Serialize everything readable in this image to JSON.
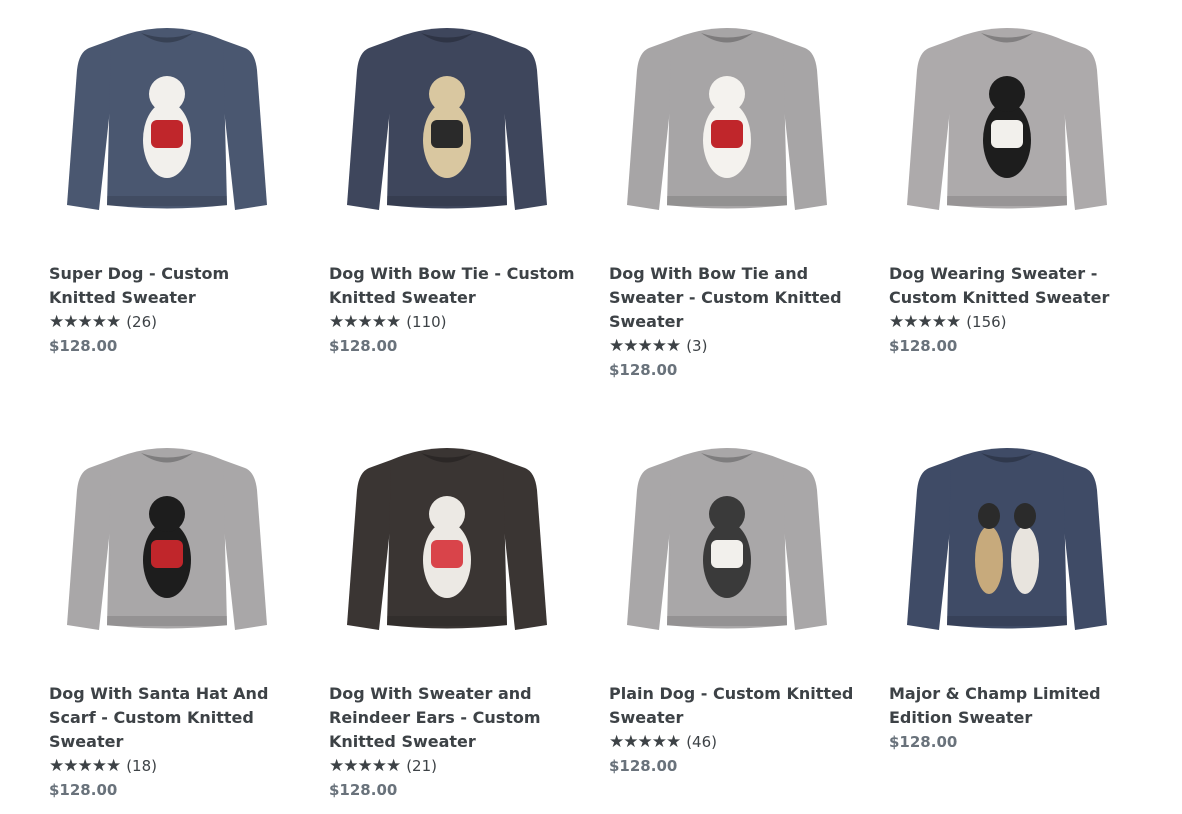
{
  "products": [
    {
      "title": "Super Dog - Custom Knitted Sweater",
      "stars_icon": "star-rating-icon",
      "rating": 5,
      "review_count": "(26)",
      "price": "$128.00",
      "sweater_color": "#4a5770",
      "dog_color": "#f2f0ec",
      "accent_color": "#c0262b"
    },
    {
      "title": "Dog With Bow Tie - Custom Knitted Sweater",
      "stars_icon": "star-rating-icon",
      "rating": 5,
      "review_count": "(110)",
      "price": "$128.00",
      "sweater_color": "#3e465c",
      "dog_color": "#d9c7a0",
      "accent_color": "#2a2a2a"
    },
    {
      "title": "Dog With Bow Tie and Sweater - Custom Knitted Sweater",
      "stars_icon": "star-rating-icon",
      "rating": 5,
      "review_count": "(3)",
      "price": "$128.00",
      "sweater_color": "#a7a5a6",
      "dog_color": "#f4f2ee",
      "accent_color": "#c0262b"
    },
    {
      "title": "Dog Wearing Sweater - Custom Knitted Sweater",
      "stars_icon": "star-rating-icon",
      "rating": 5,
      "review_count": "(156)",
      "price": "$128.00",
      "sweater_color": "#adaaab",
      "dog_color": "#1d1d1d",
      "accent_color": "#f2f0ec"
    },
    {
      "title": "Dog With Santa Hat And Scarf - Custom Knitted Sweater",
      "stars_icon": "star-rating-icon",
      "rating": 5,
      "review_count": "(18)",
      "price": "$128.00",
      "sweater_color": "#a9a7a8",
      "dog_color": "#1d1d1d",
      "accent_color": "#c0262b"
    },
    {
      "title": "Dog With Sweater and Reindeer Ears - Custom Knitted Sweater",
      "stars_icon": "star-rating-icon",
      "rating": 5,
      "review_count": "(21)",
      "price": "$128.00",
      "sweater_color": "#3a3533",
      "dog_color": "#ece9e4",
      "accent_color": "#d9444a"
    },
    {
      "title": "Plain Dog - Custom Knitted Sweater",
      "stars_icon": "star-rating-icon",
      "rating": 5,
      "review_count": "(46)",
      "price": "$128.00",
      "sweater_color": "#a9a7a8",
      "dog_color": "#3a3a3a",
      "accent_color": "#f2f0ec"
    },
    {
      "title": "Major & Champ Limited Edition Sweater",
      "stars_icon": "",
      "rating": null,
      "review_count": "",
      "price": "$128.00",
      "sweater_color": "#3f4b66",
      "dog_color": "#c7aa7c",
      "accent_color": "#2b2b2b"
    }
  ]
}
